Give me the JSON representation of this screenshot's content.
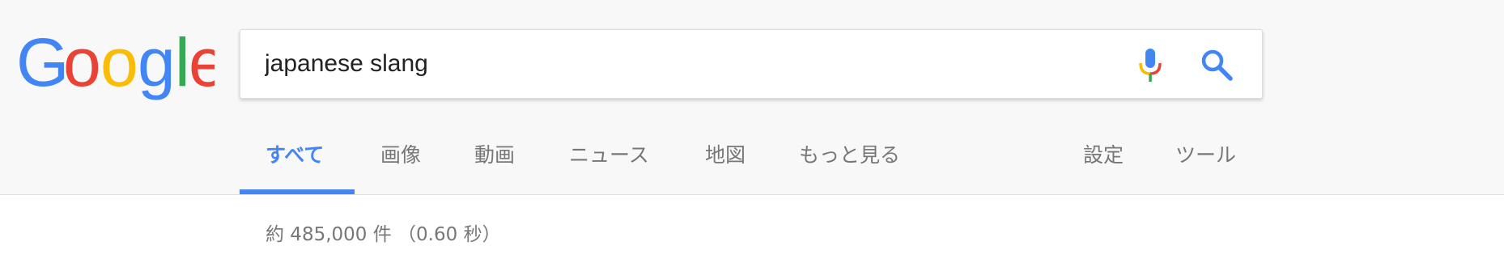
{
  "brand": {
    "logo_text": "Google",
    "logo_letter_colors": [
      "#4285f4",
      "#ea4335",
      "#fbbc05",
      "#4285f4",
      "#34a853",
      "#ea4335"
    ]
  },
  "search": {
    "query": "japanese slang",
    "mic_icon": "microphone-icon",
    "search_icon": "search-icon"
  },
  "tabs": [
    {
      "label": "すべて",
      "active": true
    },
    {
      "label": "画像",
      "active": false
    },
    {
      "label": "動画",
      "active": false
    },
    {
      "label": "ニュース",
      "active": false
    },
    {
      "label": "地図",
      "active": false
    },
    {
      "label": "もっと見る",
      "active": false
    }
  ],
  "tools": [
    {
      "label": "設定"
    },
    {
      "label": "ツール"
    }
  ],
  "results": {
    "stats": "約 485,000 件 （0.60 秒）"
  },
  "colors": {
    "accent": "#4285f4",
    "muted_text": "#777777",
    "header_bg": "#f8f8f8"
  }
}
